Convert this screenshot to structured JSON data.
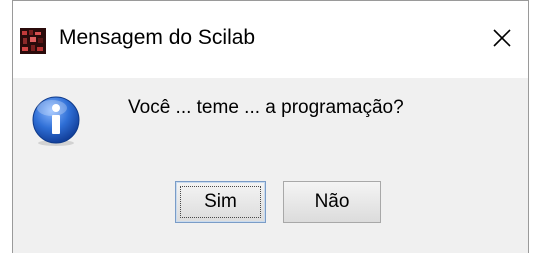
{
  "dialog": {
    "title": "Mensagem do Scilab",
    "message": "Você ... teme ... a programação?",
    "icon": "information-icon",
    "buttons": {
      "yes_label": "Sim",
      "no_label": "Não"
    }
  },
  "colors": {
    "info_icon": "#1f5fbf",
    "content_bg": "#f0f0f0",
    "titlebar_bg": "#ffffff"
  }
}
